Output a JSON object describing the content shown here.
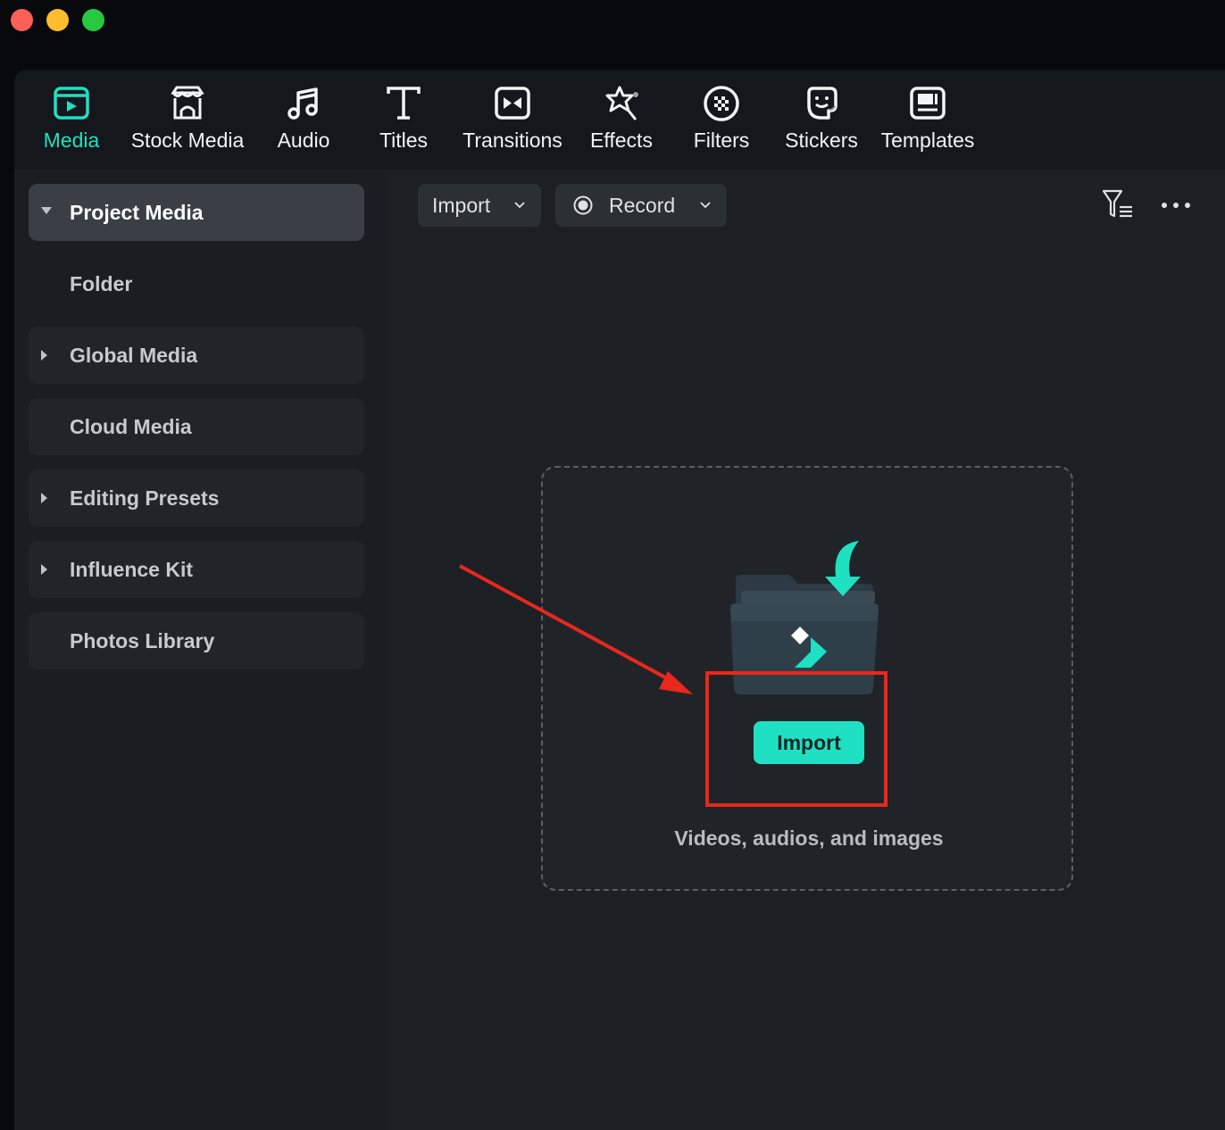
{
  "toolbar": {
    "tabs": [
      {
        "label": "Media",
        "icon": "media-icon",
        "active": true
      },
      {
        "label": "Stock Media",
        "icon": "stock-media-icon"
      },
      {
        "label": "Audio",
        "icon": "music-note-icon"
      },
      {
        "label": "Titles",
        "icon": "text-t-icon"
      },
      {
        "label": "Transitions",
        "icon": "transitions-icon"
      },
      {
        "label": "Effects",
        "icon": "effects-star-icon"
      },
      {
        "label": "Filters",
        "icon": "filters-icon"
      },
      {
        "label": "Stickers",
        "icon": "sticker-icon"
      },
      {
        "label": "Templates",
        "icon": "templates-icon"
      }
    ],
    "accent_color": "#1fe0c3"
  },
  "sidebar": {
    "items": [
      {
        "label": "Project Media",
        "expanded": true,
        "selected": true
      },
      {
        "label": "Folder"
      },
      {
        "label": "Global Media",
        "expandable": true
      },
      {
        "label": "Cloud Media"
      },
      {
        "label": "Editing Presets",
        "expandable": true
      },
      {
        "label": "Influence Kit",
        "expandable": true
      },
      {
        "label": "Photos Library"
      }
    ]
  },
  "content": {
    "import_dropdown_label": "Import",
    "record_dropdown_label": "Record",
    "filter_icon": "filter-list-icon",
    "more_icon": "more-horizontal-icon",
    "dropzone": {
      "button_label": "Import",
      "hint": "Videos, audios, and images"
    }
  },
  "annotation": {
    "color": "#e8281c"
  }
}
